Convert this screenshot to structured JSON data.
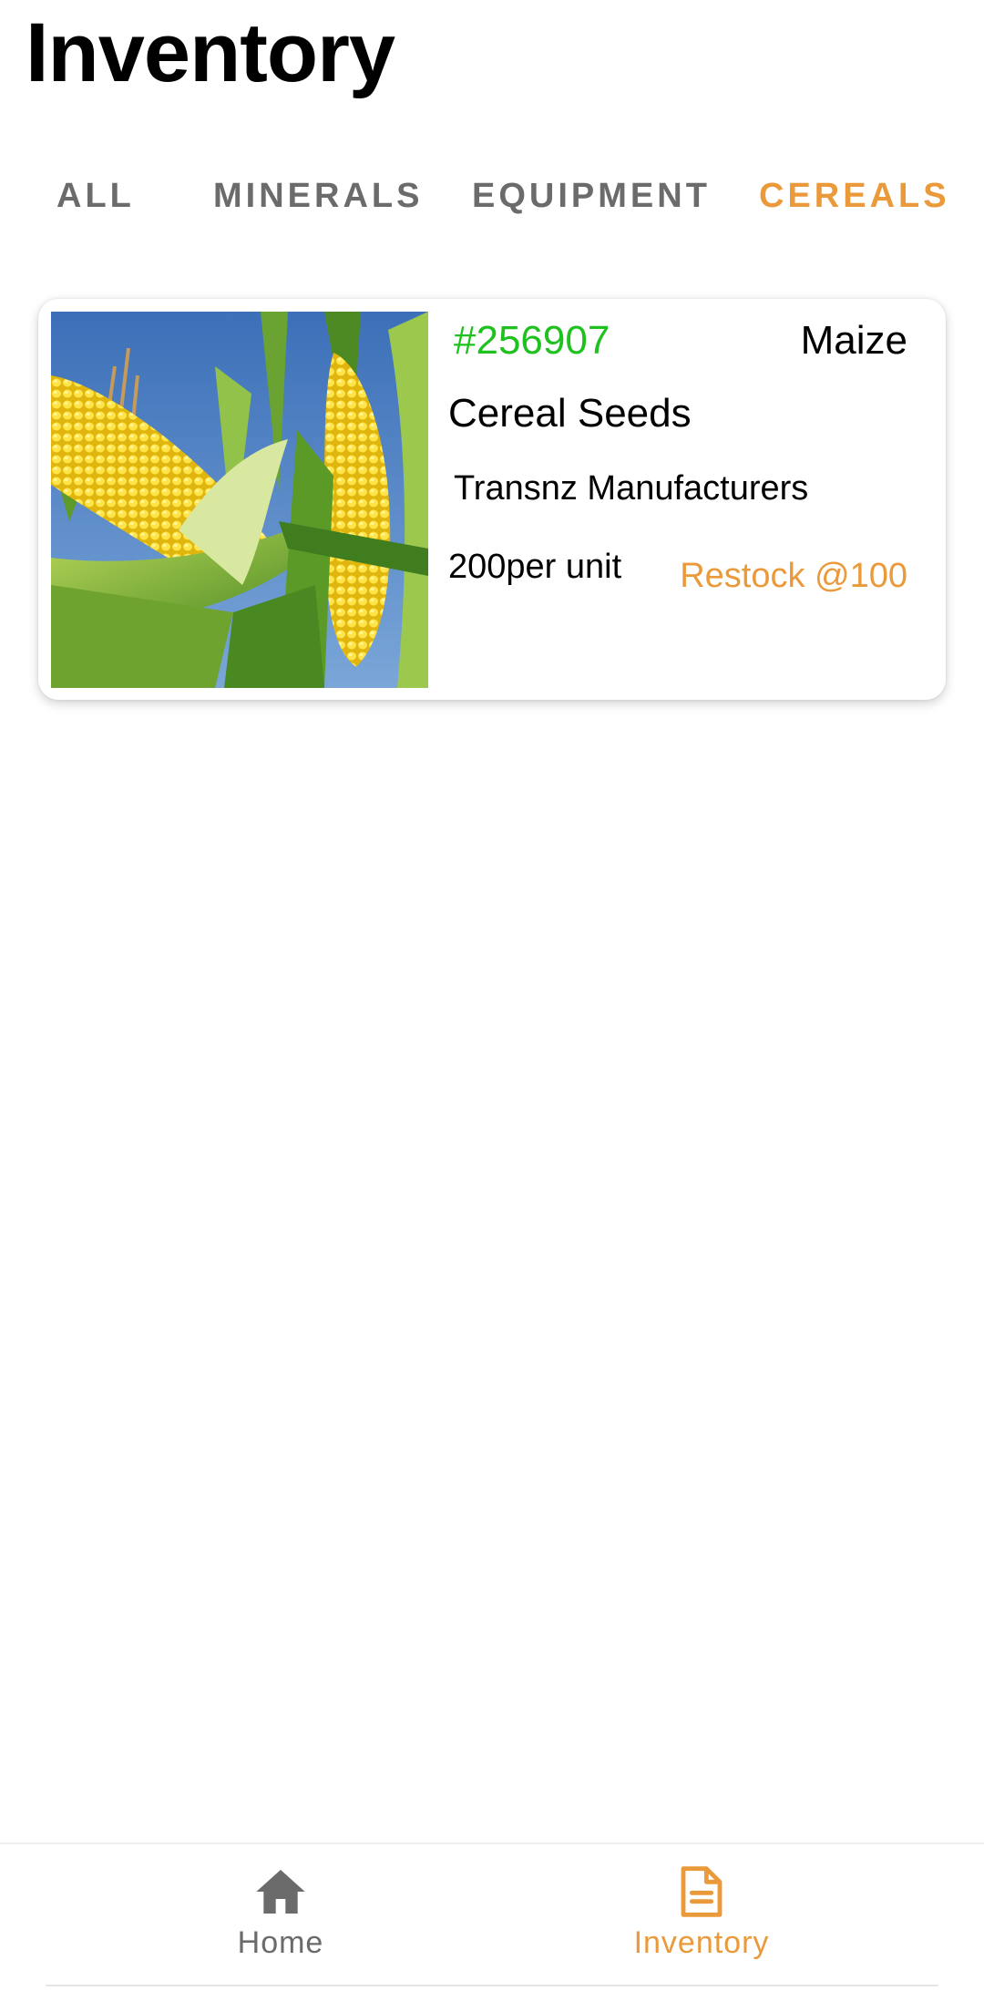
{
  "header": {
    "title": "Inventory"
  },
  "tabs": [
    {
      "label": "ALL",
      "active": false
    },
    {
      "label": "MINERALS",
      "active": false
    },
    {
      "label": "EQUIPMENT",
      "active": false
    },
    {
      "label": "CEREALS",
      "active": true
    }
  ],
  "items": [
    {
      "image_icon": "maize-photo",
      "id": "#256907",
      "variety": "Maize",
      "name": "Cereal Seeds",
      "supplier": "Transnz Manufacturers",
      "price": "200per unit",
      "restock": "Restock @100"
    }
  ],
  "bottom_nav": {
    "items": [
      {
        "label": "Home",
        "icon": "home-icon",
        "active": false
      },
      {
        "label": "Inventory",
        "icon": "document-icon",
        "active": true
      }
    ]
  },
  "colors": {
    "accent": "#ea9a3a",
    "id_green": "#1ec11e",
    "inactive": "#6b6b6b"
  }
}
